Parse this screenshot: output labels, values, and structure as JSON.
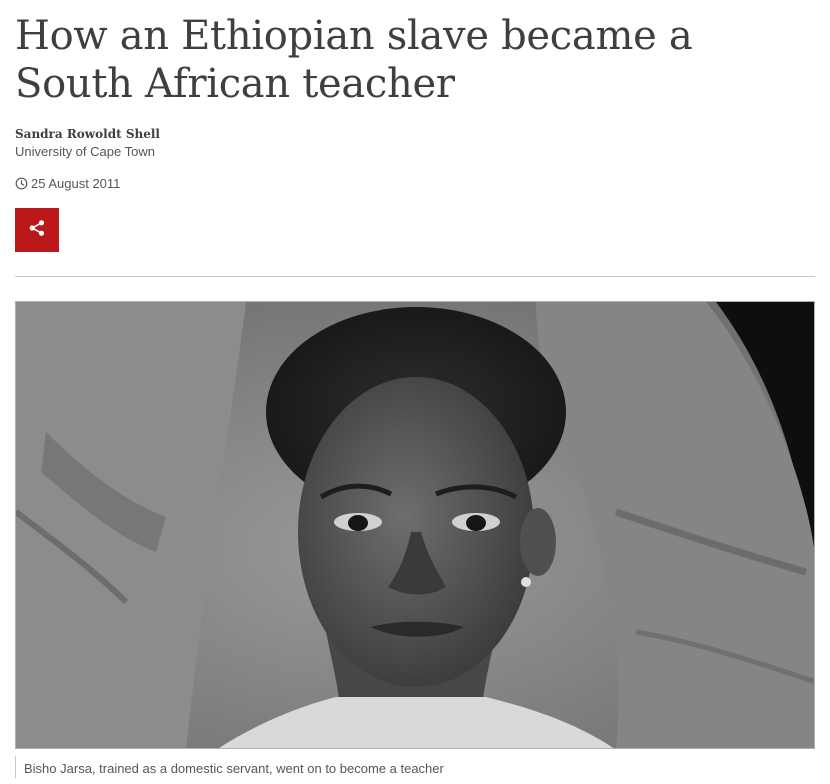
{
  "article": {
    "headline": "How an Ethiopian slave became a South African teacher",
    "author": "Sandra Rowoldt Shell",
    "author_affiliation": "University of Cape Town",
    "date": "25 August 2011",
    "share_icon": "share-icon",
    "clock_icon": "clock-icon",
    "accent_color": "#bb1919"
  },
  "image": {
    "description_alt": "Bisho Jarsa",
    "caption": "Bisho Jarsa, trained as a domestic servant, went on to become a teacher"
  }
}
